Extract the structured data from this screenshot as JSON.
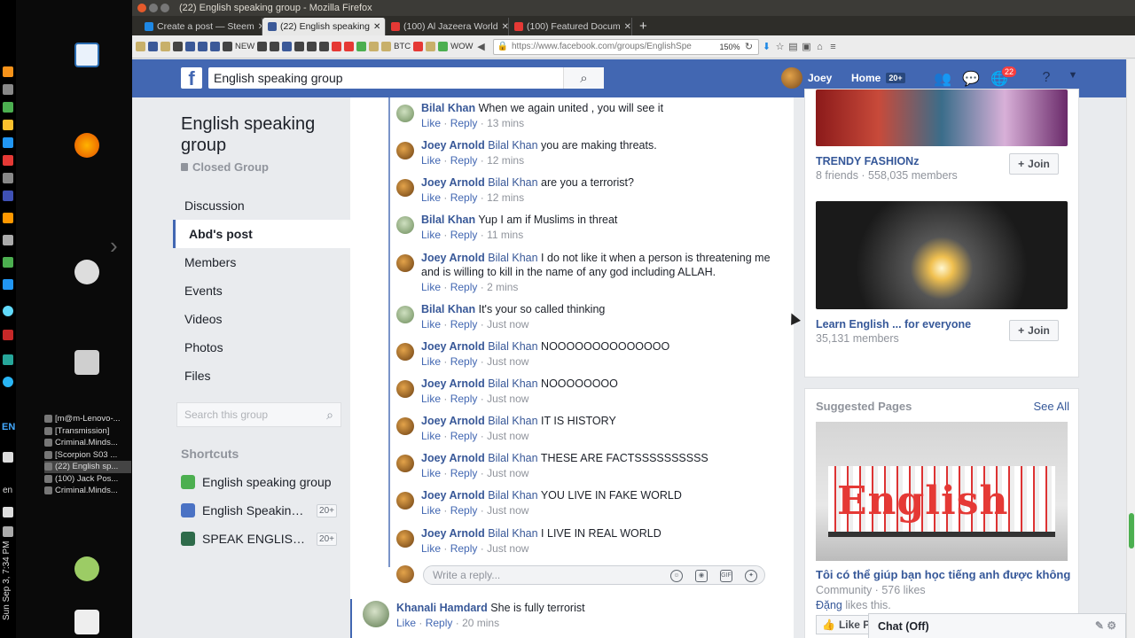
{
  "window": {
    "title": "(22) English speaking group - Mozilla Firefox"
  },
  "tabs": [
    {
      "label": "Create a post — Steem",
      "color": "#1e88e5",
      "active": false
    },
    {
      "label": "(22) English speaking",
      "color": "#3b5998",
      "active": true
    },
    {
      "label": "(100) Al Jazeera World",
      "color": "#e53935",
      "active": false
    },
    {
      "label": "(100) Featured Docum",
      "color": "#e53935",
      "active": false
    }
  ],
  "bookmarks": [
    "NEW",
    "BTC",
    "WOW"
  ],
  "url": {
    "text": "https://www.facebook.com/groups/EnglishSpe",
    "zoom": "150%"
  },
  "fb": {
    "search_value": "English speaking group",
    "user_name": "Joey",
    "home_label": "Home",
    "home_badge": "20+",
    "notif_count": "22"
  },
  "group": {
    "title": "English speaking group",
    "type": "Closed Group",
    "nav": [
      "Discussion",
      "Abd's post",
      "Members",
      "Events",
      "Videos",
      "Photos",
      "Files"
    ],
    "active_nav": 1,
    "search_placeholder": "Search this group",
    "shortcuts_heading": "Shortcuts",
    "shortcuts": [
      {
        "label": "English speaking group",
        "count": "",
        "color": "#4caf50"
      },
      {
        "label": "English Speaking ...",
        "count": "20+",
        "color": "#4a72c4"
      },
      {
        "label": "SPEAK ENGLISH ...",
        "count": "20+",
        "color": "#2e6b4a"
      }
    ]
  },
  "comments": [
    {
      "author": "Bilal Khan",
      "tag": "",
      "text": "When we again united , you will see it",
      "time": "13 mins",
      "avatar": "bilal"
    },
    {
      "author": "Joey Arnold",
      "tag": "Bilal Khan",
      "text": "you are making threats.",
      "time": "12 mins",
      "avatar": "joey"
    },
    {
      "author": "Joey Arnold",
      "tag": "Bilal Khan",
      "text": "are you a terrorist?",
      "time": "12 mins",
      "avatar": "joey"
    },
    {
      "author": "Bilal Khan",
      "tag": "",
      "text": "Yup I am if Muslims in threat",
      "time": "11 mins",
      "avatar": "bilal"
    },
    {
      "author": "Joey Arnold",
      "tag": "Bilal Khan",
      "text": "I do not like it when a person is threatening me and is willing to kill in the name of any god including ALLAH.",
      "time": "2 mins",
      "avatar": "joey"
    },
    {
      "author": "Bilal Khan",
      "tag": "",
      "text": "It's your so called thinking",
      "time": "Just now",
      "avatar": "bilal"
    },
    {
      "author": "Joey Arnold",
      "tag": "Bilal Khan",
      "text": "NOOOOOOOOOOOOOO",
      "time": "Just now",
      "avatar": "joey"
    },
    {
      "author": "Joey Arnold",
      "tag": "Bilal Khan",
      "text": "NOOOOOOOO",
      "time": "Just now",
      "avatar": "joey"
    },
    {
      "author": "Joey Arnold",
      "tag": "Bilal Khan",
      "text": "IT IS HISTORY",
      "time": "Just now",
      "avatar": "joey"
    },
    {
      "author": "Joey Arnold",
      "tag": "Bilal Khan",
      "text": "THESE ARE FACTSSSSSSSSSS",
      "time": "Just now",
      "avatar": "joey"
    },
    {
      "author": "Joey Arnold",
      "tag": "Bilal Khan",
      "text": "YOU LIVE IN FAKE WORLD",
      "time": "Just now",
      "avatar": "joey"
    },
    {
      "author": "Joey Arnold",
      "tag": "Bilal Khan",
      "text": "I LIVE IN REAL WORLD",
      "time": "Just now",
      "avatar": "joey"
    }
  ],
  "actions": {
    "like": "Like",
    "reply": "Reply",
    "sep": "·"
  },
  "reply": {
    "placeholder": "Write a reply..."
  },
  "khanali": {
    "author": "Khanali Hamdard",
    "text": "She is fully terrorist",
    "time": "20 mins"
  },
  "suggested_groups": [
    {
      "name": "TRENDY FASHIONz",
      "meta": "8 friends · 558,035 members",
      "join": "Join"
    },
    {
      "name": "Learn English ... for everyone",
      "meta": "35,131 members",
      "join": "Join"
    }
  ],
  "suggested_pages": {
    "title": "Suggested Pages",
    "see_all": "See All",
    "image_text": "English",
    "name": "Tôi có thể giúp bạn học tiếng anh được không",
    "meta": "Community · 576 likes",
    "liker": "Đặng",
    "likes_suffix": "likes this.",
    "like_btn": "Like P"
  },
  "chat": {
    "label": "Chat (Off)"
  },
  "os": {
    "lang": "EN",
    "kb": "en",
    "clock": "Sun Sep 3, 7:34 PM"
  },
  "taskbar": [
    "[m@m-Lenovo-...",
    "[Transmission]",
    "Criminal.Minds...",
    "[Scorpion S03 ...",
    "(22) English sp...",
    "(100) Jack Pos...",
    "Criminal.Minds..."
  ],
  "taskbar_active": 4
}
